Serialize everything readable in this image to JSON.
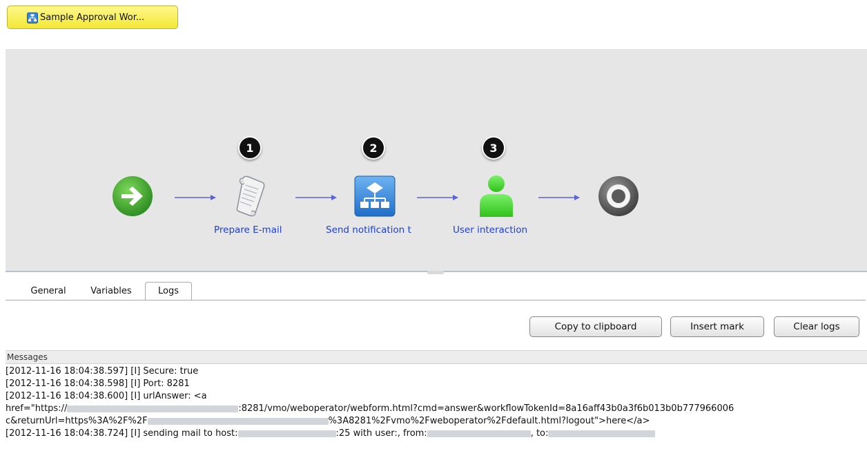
{
  "workflow_tab": {
    "label": "Sample Approval Wor..."
  },
  "diagram": {
    "nodes": [
      {
        "label": "Prepare E-mail",
        "badge": "1"
      },
      {
        "label": "Send notification t",
        "badge": "2"
      },
      {
        "label": "User interaction",
        "badge": "3"
      }
    ]
  },
  "tabs": [
    {
      "label": "General"
    },
    {
      "label": "Variables"
    },
    {
      "label": "Logs"
    }
  ],
  "actions": {
    "copy": "Copy to clipboard",
    "insert_mark": "Insert mark",
    "clear_logs": "Clear logs"
  },
  "messages": {
    "header": "Messages",
    "lines": [
      {
        "a": "[2012-11-16 18:04:38.597] [I] Secure: true"
      },
      {
        "a": "[2012-11-16 18:04:38.598] [I] Port: 8281"
      },
      {
        "a": "[2012-11-16 18:04:38.600] [I] urlAnswer: <a"
      },
      {
        "a": "href=\"https://",
        "b": ":8281/vmo/weboperator/webform.html?cmd=answer&workflowTokenId=8a16aff43b0a3f6b013b0b777966006"
      },
      {
        "a": "c&returnUrl=https%3A%2F%2F",
        "b": "%3A8281%2Fvmo%2Fweboperator%2Fdefault.html?logout\">here</a>"
      },
      {
        "a": "[2012-11-16 18:04:38.724] [I] sending mail to host:",
        "b": ":25 with user:, from:",
        "c": ", to:"
      }
    ]
  },
  "colors": {
    "canvas": "#e6e6e6",
    "link": "#1f3fd0",
    "arrow": "#5b63d8",
    "button_yellow": "#f3e836"
  }
}
